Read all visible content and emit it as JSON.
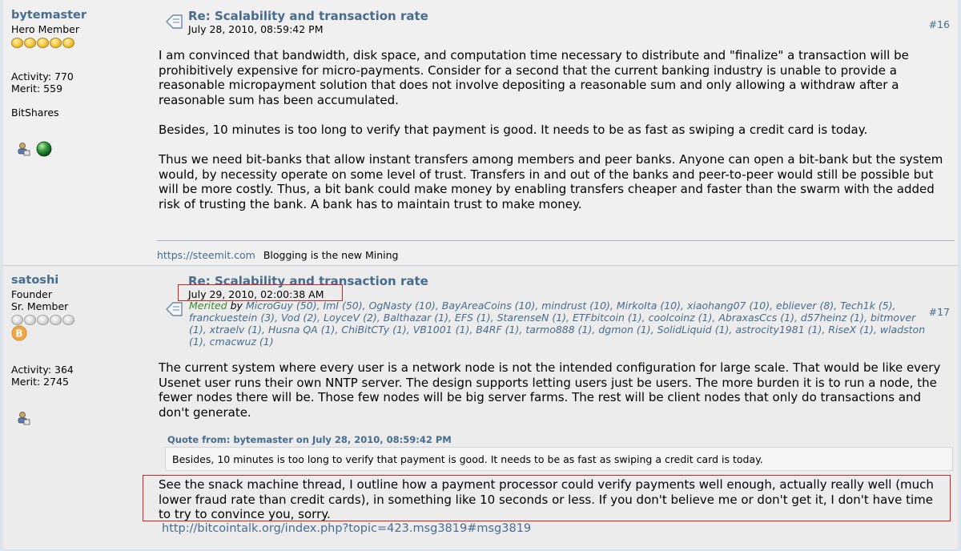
{
  "post1": {
    "author": "bytemaster",
    "rank": "Hero Member",
    "stars": [
      "gold",
      "gold",
      "gold",
      "gold",
      "gold"
    ],
    "activity": "Activity: 770",
    "merit": "Merit: 559",
    "custom_title": "BitShares",
    "subject": "Re: Scalability and transaction rate",
    "date": "July 28, 2010, 08:59:42 PM",
    "msg_number": "#16",
    "paragraphs": [
      "I am convinced that bandwidth, disk space, and computation time necessary to distribute and \"finalize\" a transaction will be prohibitively expensive for micro-payments.  Consider for a second that the current banking industry is unable to provide a reasonable micropayment solution that does not involve depositing a reasonable sum and only allowing a withdraw after a reasonable sum has been accumulated.",
      "Besides, 10 minutes is too long to verify that payment is good.  It needs to be as fast as swiping a credit card is today.",
      "Thus we need bit-banks that allow instant transfers among members and peer banks.   Anyone can open a bit-bank but the system would, by necessity operate on some level of trust.  Transfers in and out of the banks and peer-to-peer would still be possible but will be more costly.   Thus, a bit bank could make money by enabling transfers cheaper and faster than the swarm with the added risk of trusting the bank.  A bank has to maintain trust to make money."
    ],
    "signature_link": "https://steemit.com",
    "signature_text": "Blogging is the new Mining"
  },
  "post2": {
    "author": "satoshi",
    "role": "Founder",
    "rank": "Sr. Member",
    "stars": [
      "grey",
      "grey",
      "grey",
      "grey",
      "grey"
    ],
    "activity": "Activity: 364",
    "merit": "Merit: 2745",
    "subject": "Re: Scalability and transaction rate",
    "date": "July 29, 2010, 02:00:38 AM",
    "msg_number": "#17",
    "merited_label": "Merited",
    "merited_by": "by",
    "merited_list": "MicroGuy (50), ImI (50), OgNasty (10), BayAreaCoins (10), mindrust (10), MirkoIta (10), xiaohang07 (10), ebliever (8), Tech1k (5), franckuestein (3), Vod (2), LoyceV (2), Balthazar (1), EFS (1), StarenseN (1), ETFbitcoin (1), coolcoinz (1), AbraxasCcs (1), d57heinz (1), bitmover (1), xtraelv (1), Husna QA (1), ChiBitCTy (1), VB1001 (1), B4RF (1), tarmo888 (1), dgmon (1), SolidLiquid (1), astrocity1981 (1), RiseX (1), wladston (1), cmacwuz (1)",
    "paragraph1": "The current system where every user is a network node is not the intended configuration for large scale.  That would be like every Usenet user runs their own NNTP server.  The design supports letting users just be users.  The more burden it is to run a node, the fewer nodes there will be.  Those few nodes will be big server farms.  The rest will be client nodes that only do transactions and don't generate.",
    "quote_header": "Quote from: bytemaster on July 28, 2010, 08:59:42 PM",
    "quote_text": "Besides, 10 minutes is too long to verify that payment is good.  It needs to be as fast as swiping a credit card is today.",
    "paragraph2": "See the snack machine thread, I outline how a payment processor could verify payments well enough, actually really well (much lower fraud rate than credit cards), in something like 10 seconds or less.  If you don't believe me or don't get it, I don't have time to try to convince you, sorry.",
    "msg_link": "http://bitcointalk.org/index.php?topic=423.msg3819#msg3819"
  }
}
